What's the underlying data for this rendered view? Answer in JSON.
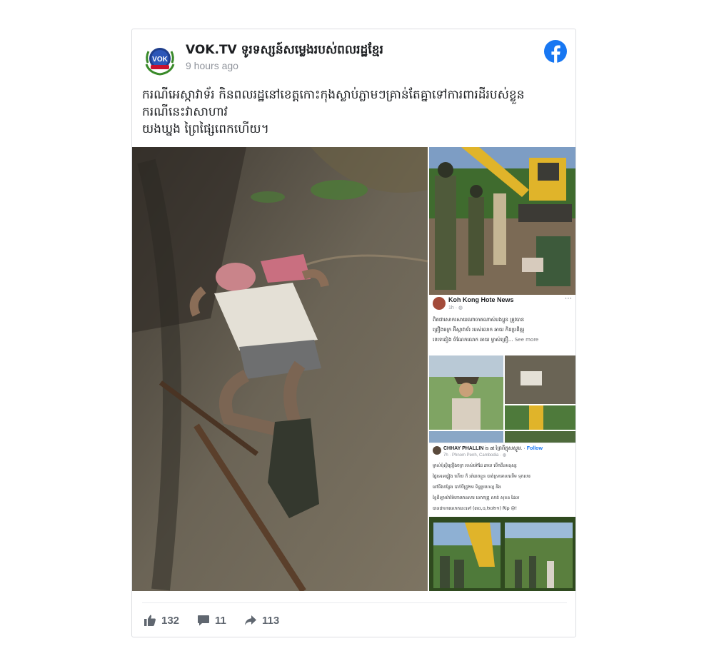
{
  "post": {
    "page_name": "VOK.TV ទូរទស្សន៍សម្លេងរបស់ពលរដ្ឋខ្មែរ",
    "timestamp": "9 hours ago",
    "avatar_text": "VOK",
    "text_lines": [
      "ករណីអេស្កាវាទ័រ កិនពលរដ្ឋនៅខេត្តកោះកុងស្លាប់ភ្លាមៗគ្រាន់តែគ្នាទៅការពារដីរបស់ខ្លួន",
      "ករណីនេះវាសាហាវ",
      "យងឃ្នង ព្រៃផ្សៃពេកហើយ។"
    ]
  },
  "embedded_post_1": {
    "page_name": "Koh Kong Hote News",
    "time": "1h · ◍",
    "lines": [
      "ពិតជាសោកសោយណាចាតណាស់បងប្អូន ត្រូវបាន",
      "ព្រឿងចក្រ អ៊ិស្កាវាទ័រ របស់លោក ឆាយ កិនប្រពីគ្មរុ",
      "ទេទេដៀង ចំណែកលោក ឆាយ ម្ចាស់ព្រឿ..."
    ],
    "see_more": "See more"
  },
  "embedded_post_2": {
    "name": "CHHAY PHALLIN",
    "is_at": "is at ព្រៃពីភ្នុសស្លូម. ·",
    "follow": "Follow",
    "meta": "7h · Phnom Penh, Cambodia · ◍",
    "lines": [
      "ម្ចាស់ប៉ុស្ថិព្រឿងចក្រ របស់ម៉ៅដែ ឆាយ បើកពីនមនុស្ស",
      "ផ្ទៃទេទេធ្វៀង ហើយ ក៏ រត់គេចខ្លួន បាត់ស្រទោលលើម ទុកសារ",
      "នៅនឹងកន្លែង បាក់បីត្រូ២ម ទិន្នប្រហេល្ម និង",
      "ខ្ទៃពីឡាយ៉ាម៉ែកោមោនសារ លោកគ្រូ សាត់ សុខន ដែល",
      "បានជាហារលោកនេះទៅ (៣០,០,២០២១) Rip 😥!"
    ]
  },
  "reactions": {
    "likes": "132",
    "comments": "11",
    "shares": "113"
  },
  "colors": {
    "facebook_blue": "#1877f2",
    "text": "#1c1e21",
    "muted": "#90949c",
    "action": "#606770"
  },
  "icons": {
    "brand": "facebook-logo-icon",
    "like": "thumbs-up-icon",
    "comment": "speech-bubble-icon",
    "share": "share-arrow-icon"
  }
}
